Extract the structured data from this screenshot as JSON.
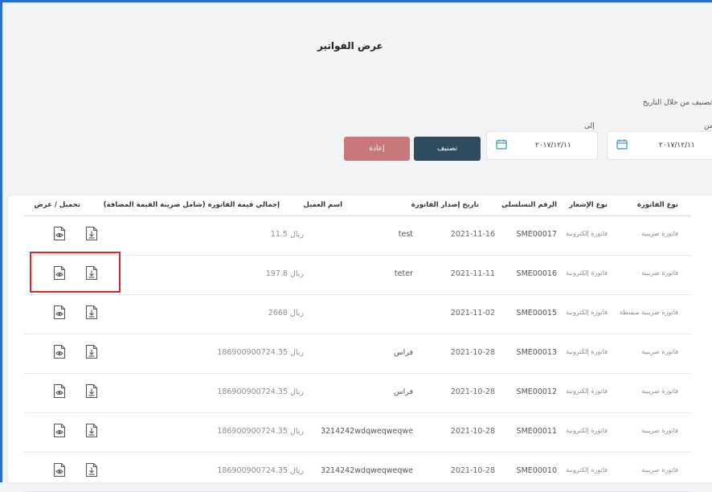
{
  "page": {
    "title": "عرض الفواتير"
  },
  "filter": {
    "caption": "تصنيف من خلال التاريخ",
    "from_label": "من",
    "to_label": "إلى",
    "from_value": "٢٠١٧/١٢/١١",
    "to_value": "٢٠١٧/١٢/١١",
    "classify_button": "تصنيف",
    "reset_button": "إعادة"
  },
  "table": {
    "headers": {
      "invoice_type": "نوع الفاتورة",
      "notice_type": "نوع الإشعار",
      "serial": "الرقم التسلسلي",
      "issue_date": "تاريخ إصدار الفاتورة",
      "customer": "اسم العميل",
      "total": "إجمالي قيمة الفاتورة (شامل ضريبة القيمة المضافة)",
      "actions": "تحميل / عرض"
    },
    "rows": [
      {
        "invoice_type": "فاتورة ضريبية",
        "notice_type": "فاتورة إلكترونية",
        "serial": "SME00017",
        "date": "2021-11-16",
        "customer": "test",
        "total": "11.5 ريال"
      },
      {
        "invoice_type": "فاتورة ضريبية",
        "notice_type": "فاتورة إلكترونية",
        "serial": "SME00016",
        "date": "2021-11-11",
        "customer": "teter",
        "total": "197.8 ريال"
      },
      {
        "invoice_type": "فاتورة ضريبية مبسطة",
        "notice_type": "فاتورة إلكترونية",
        "serial": "SME00015",
        "date": "2021-11-02",
        "customer": "",
        "total": "2668 ريال"
      },
      {
        "invoice_type": "فاتورة ضريبية",
        "notice_type": "فاتورة إلكترونية",
        "serial": "SME00013",
        "date": "2021-10-28",
        "customer": "فراس",
        "total": "186900900724.35 ريال"
      },
      {
        "invoice_type": "فاتورة ضريبية",
        "notice_type": "فاتورة إلكترونية",
        "serial": "SME00012",
        "date": "2021-10-28",
        "customer": "فراس",
        "total": "186900900724.35 ريال"
      },
      {
        "invoice_type": "فاتورة ضريبية",
        "notice_type": "فاتورة إلكترونية",
        "serial": "SME00011",
        "date": "2021-10-28",
        "customer": "3214242wdqweqweqwe",
        "total": "186900900724.35 ريال"
      },
      {
        "invoice_type": "فاتورة ضريبية",
        "notice_type": "فاتورة إلكترونية",
        "serial": "SME00010",
        "date": "2021-10-28",
        "customer": "3214242wdqweqweqwe",
        "total": "186900900724.35 ريال"
      }
    ]
  },
  "colors": {
    "frame": "#2c6fc9",
    "classify_button": "#2e4c5d",
    "reset_button": "#c9787a",
    "highlight": "#d62a2a"
  },
  "icons": {
    "view": "eye-document-icon",
    "download": "download-document-icon",
    "calendar": "calendar-icon"
  }
}
